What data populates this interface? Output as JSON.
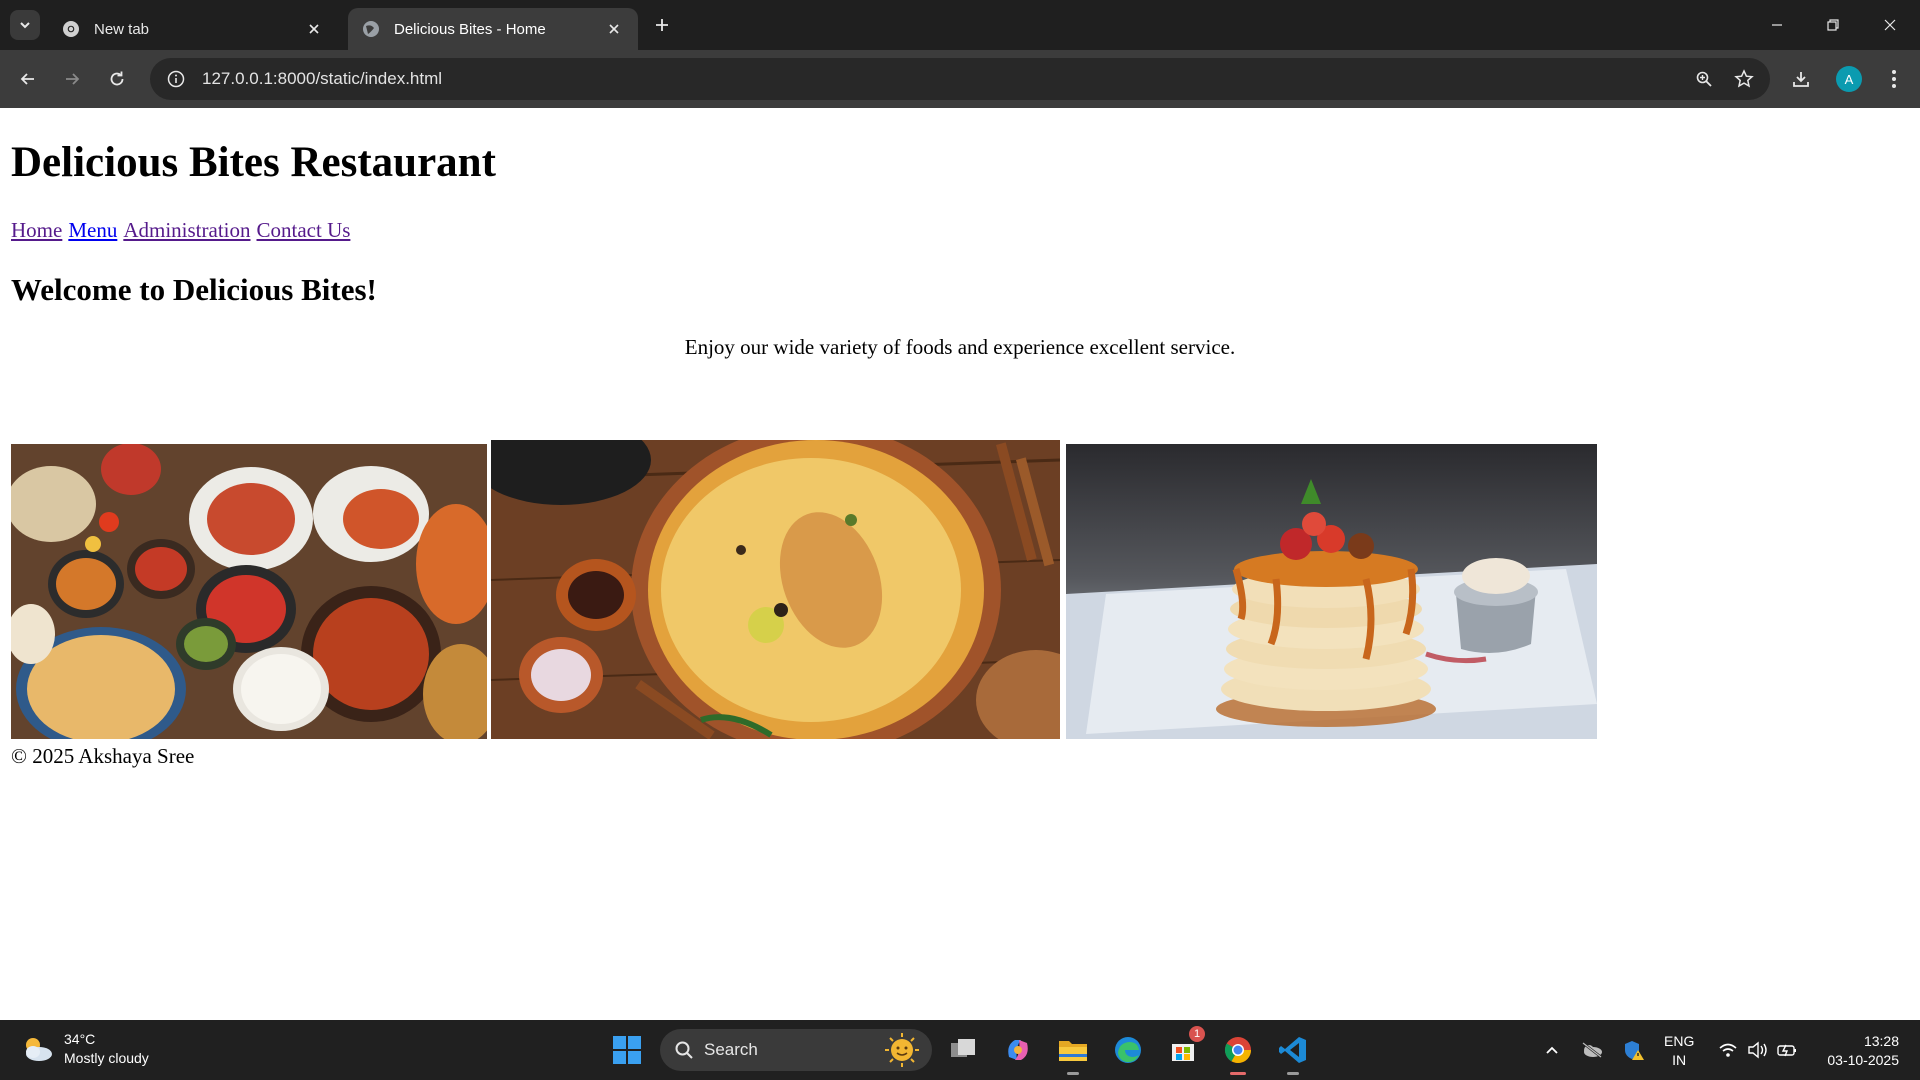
{
  "browser": {
    "tabs": [
      {
        "title": "New tab",
        "icon": "chrome-icon",
        "active": false
      },
      {
        "title": "Delicious Bites - Home",
        "icon": "globe-icon",
        "active": true
      }
    ],
    "url": "127.0.0.1:8000/static/index.html",
    "profile_initial": "A"
  },
  "page": {
    "site_title": "Delicious Bites Restaurant",
    "nav_links": [
      "Home",
      "Menu",
      "Administration",
      "Contact Us"
    ],
    "welcome_heading": "Welcome to Delicious Bites!",
    "intro_text": "Enjoy our wide variety of foods and experience excellent service.",
    "images": [
      "indian-food-spread-photo",
      "biryani-photo",
      "pancakes-photo"
    ],
    "footer": "© 2025 Akshaya Sree"
  },
  "taskbar": {
    "weather": {
      "temp": "34°C",
      "condition": "Mostly cloudy"
    },
    "search_label": "Search",
    "store_badge": "1",
    "language": {
      "line1": "ENG",
      "line2": "IN"
    },
    "clock": {
      "time": "13:28",
      "date": "03-10-2025"
    }
  },
  "colors": {
    "tabstrip": "#1f1f1f",
    "toolbar": "#3c3c3c",
    "visited_link": "#551a8b",
    "unvisited_link": "#0000ee",
    "taskbar": "#202020"
  }
}
